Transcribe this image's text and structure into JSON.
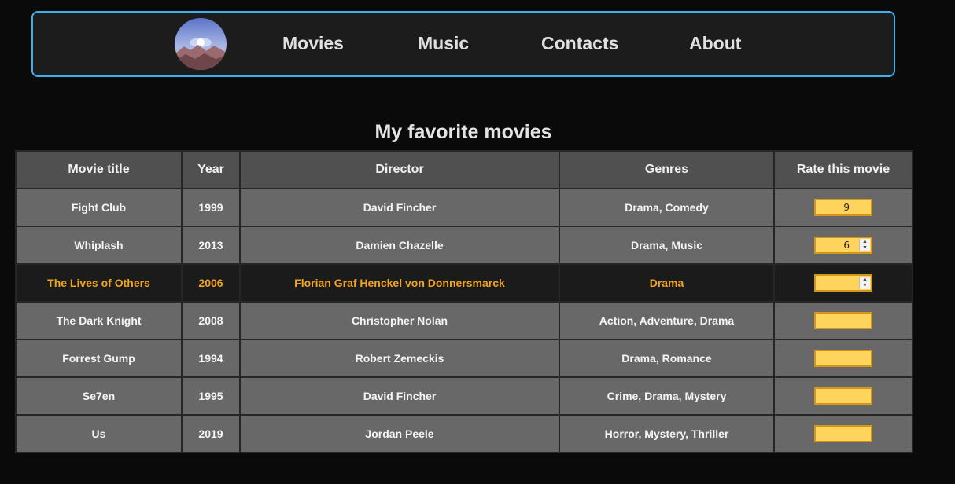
{
  "nav": {
    "links": [
      "Movies",
      "Music",
      "Contacts",
      "About"
    ]
  },
  "page": {
    "title": "My favorite movies"
  },
  "table": {
    "headers": [
      "Movie title",
      "Year",
      "Director",
      "Genres",
      "Rate this movie"
    ],
    "rows": [
      {
        "title": "Fight Club",
        "year": "1999",
        "director": "David Fincher",
        "genres": "Drama, Comedy",
        "rating": "9"
      },
      {
        "title": "Whiplash",
        "year": "2013",
        "director": "Damien Chazelle",
        "genres": "Drama, Music",
        "rating": "6"
      },
      {
        "title": "The Lives of Others",
        "year": "2006",
        "director": "Florian Graf Henckel von Donnersmarck",
        "genres": "Drama",
        "rating": ""
      },
      {
        "title": "The Dark Knight",
        "year": "2008",
        "director": "Christopher Nolan",
        "genres": "Action, Adventure, Drama",
        "rating": ""
      },
      {
        "title": "Forrest Gump",
        "year": "1994",
        "director": "Robert Zemeckis",
        "genres": "Drama, Romance",
        "rating": ""
      },
      {
        "title": "Se7en",
        "year": "1995",
        "director": "David Fincher",
        "genres": "Crime, Drama, Mystery",
        "rating": ""
      },
      {
        "title": "Us",
        "year": "2019",
        "director": "Jordan Peele",
        "genres": "Horror, Mystery, Thriller",
        "rating": ""
      }
    ]
  },
  "colors": {
    "page_background": "#0a0a0a",
    "navbar_border": "#3fb0ee",
    "highlight_text": "#f1a41e",
    "rating_input": "#ffd45c"
  },
  "icons": {
    "logo": "mountain-landscape-logo",
    "spinner": "spinner-arrows-icon"
  }
}
